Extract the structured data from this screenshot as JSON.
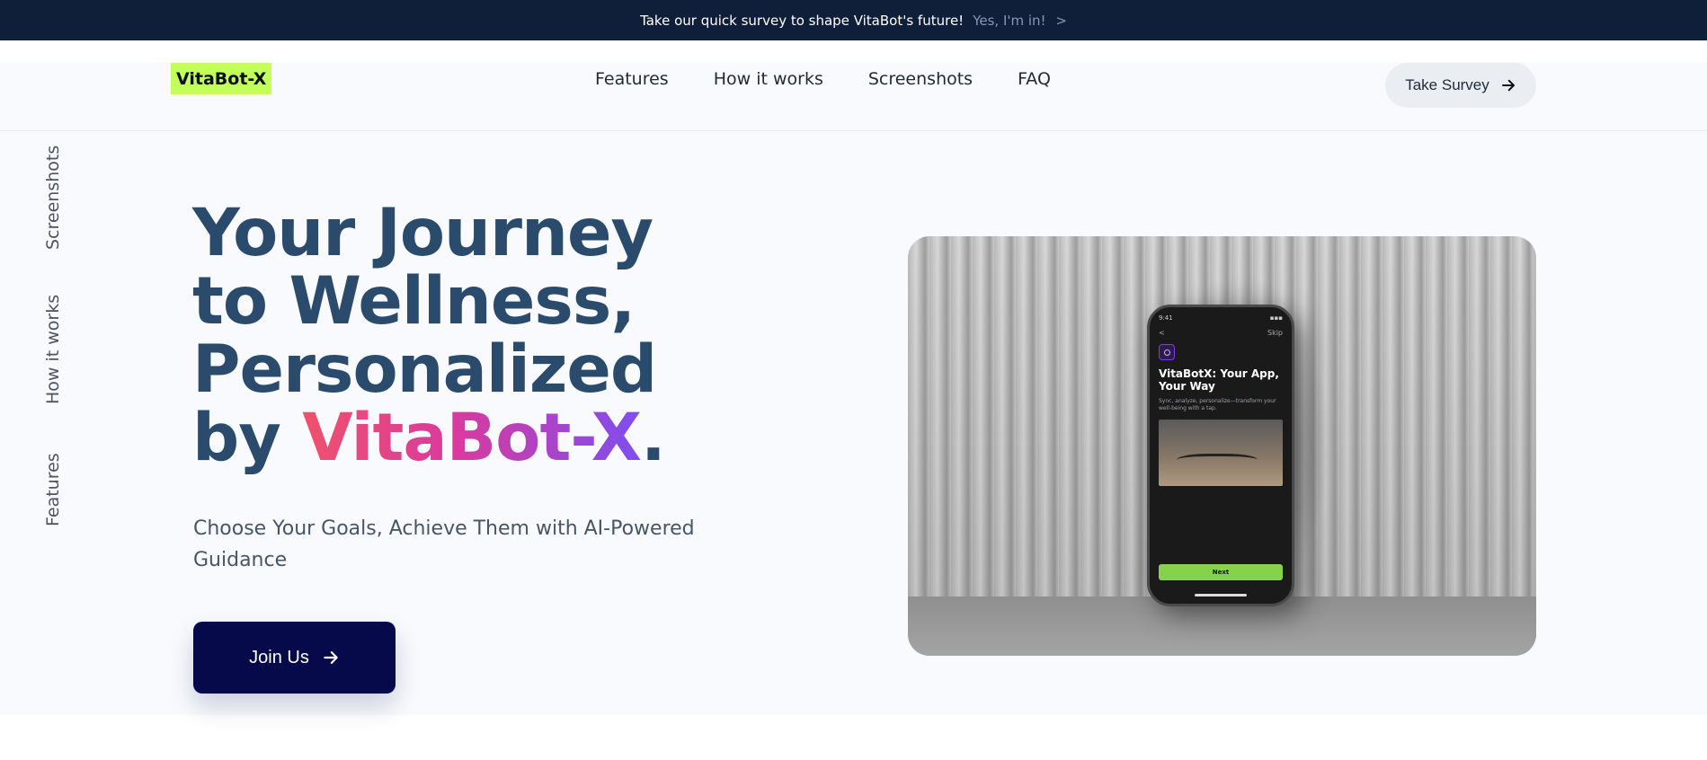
{
  "announcement": {
    "message": "Take our quick survey to shape VitaBot's future!",
    "cta": "Yes, I'm in!",
    "chevron": ">"
  },
  "header": {
    "logo": "VitaBot-X",
    "nav": [
      {
        "label": "Features"
      },
      {
        "label": "How it works"
      },
      {
        "label": "Screenshots"
      },
      {
        "label": "FAQ"
      }
    ],
    "survey_button": "Take Survey",
    "survey_icon": "arrow-right-icon"
  },
  "side_nav": [
    {
      "label": "Screenshots"
    },
    {
      "label": "How it works"
    },
    {
      "label": "Features"
    }
  ],
  "hero": {
    "title_lines": [
      "Your Journey",
      "to Wellness,",
      "Personalized"
    ],
    "title_by": "by",
    "title_brand": "VitaBot-X",
    "title_dot": ".",
    "subtitle": "Choose Your Goals, Achieve Them with AI-Powered Guidance",
    "join_button": "Join Us",
    "join_icon": "arrow-right-icon",
    "brand_gradient": [
      "#f0516c",
      "#d93a9e",
      "#7d4ef0"
    ]
  },
  "phone_screen": {
    "time": "9:41",
    "back": "<",
    "skip": "Skip",
    "title": "VitaBotX: Your App, Your Way",
    "subtitle": "Sync, analyze, personalize—transform your well-being with a tap.",
    "next_button": "Next"
  },
  "colors": {
    "topbar_bg": "#0f1f3a",
    "logo_bg": "#c2ff5b",
    "title": "#2b4b6c",
    "join_button_bg": "#060a4a",
    "hero_bg": "#f8fafd"
  }
}
